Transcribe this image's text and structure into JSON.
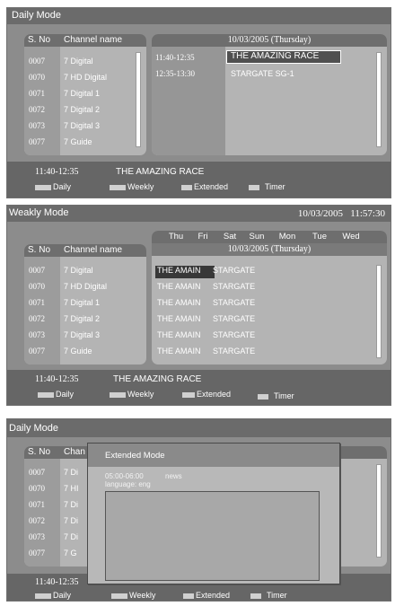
{
  "panel1": {
    "title": "Daily Mode",
    "col_sno": "S. No",
    "col_channel": "Channel name",
    "date_header": "10/03/2005  (Thursday)",
    "channels": [
      {
        "no": "0007",
        "name": "7 Digital"
      },
      {
        "no": "0070",
        "name": "7 HD Digital"
      },
      {
        "no": "0071",
        "name": "7 Digital 1"
      },
      {
        "no": "0072",
        "name": "7 Digital 2"
      },
      {
        "no": "0073",
        "name": "7 Digital 3"
      },
      {
        "no": "0077",
        "name": "7 Guide"
      }
    ],
    "programs": [
      {
        "time": "11:40-12:35",
        "title": "THE AMAZING RACE"
      },
      {
        "time": "12:35-13:30",
        "title": "STARGATE SG-1"
      }
    ],
    "status_time": "11:40-12:35",
    "status_title": "THE AMAZING RACE",
    "legend": {
      "daily": "Daily",
      "weekly": "Weekly",
      "extended": "Extended",
      "timer": "Timer"
    }
  },
  "panel2": {
    "title": "Weakly Mode",
    "datetime": "10/03/2005   11:57:30",
    "days": [
      "Thu",
      "Fri",
      "Sat",
      "Sun",
      "Mon",
      "Tue",
      "Wed"
    ],
    "date_header": "10/03/2005  (Thursday)",
    "col_sno": "S. No",
    "col_channel": "Channel name",
    "channels": [
      {
        "no": "0007",
        "name": "7 Digital"
      },
      {
        "no": "0070",
        "name": "7 HD Digital"
      },
      {
        "no": "0071",
        "name": "7 Digital 1"
      },
      {
        "no": "0072",
        "name": "7 Digital 2"
      },
      {
        "no": "0073",
        "name": "7 Digital 3"
      },
      {
        "no": "0077",
        "name": "7 Guide"
      }
    ],
    "grid": [
      {
        "a": "THE AMAIN",
        "b": "STARGATE"
      },
      {
        "a": "THE AMAIN",
        "b": "STARGATE"
      },
      {
        "a": "THE AMAIN",
        "b": "STARGATE"
      },
      {
        "a": "THE AMAIN",
        "b": "STARGATE"
      },
      {
        "a": "THE AMAIN",
        "b": "STARGATE"
      },
      {
        "a": "THE AMAIN",
        "b": "STARGATE"
      }
    ],
    "status_time": "11:40-12:35",
    "status_title": "THE AMAZING RACE",
    "legend": {
      "daily": "Daily",
      "weekly": "Weekly",
      "extended": "Extended",
      "timer": "Timer"
    }
  },
  "panel3": {
    "title": "Daily Mode",
    "col_sno": "S. No",
    "col_channel": "Chan",
    "channels": [
      {
        "no": "0007",
        "name": "7 Di"
      },
      {
        "no": "0070",
        "name": "7 HI"
      },
      {
        "no": "0071",
        "name": "7 Di"
      },
      {
        "no": "0072",
        "name": "7 Di"
      },
      {
        "no": "0073",
        "name": "7 Di"
      },
      {
        "no": "0077",
        "name": "7 G"
      }
    ],
    "status_time": "11:40-12:35",
    "extended": {
      "title": "Extended Mode",
      "time": "05:00-06:00",
      "program": "news",
      "language": "language: eng"
    },
    "legend": {
      "daily": "Daily",
      "weekly": "Weekly",
      "extended": "Extended",
      "timer": "Timer"
    }
  },
  "colors": {
    "background": "#8c8c8c",
    "titlebar": "#6b6b6b",
    "panel": "#b4b4b4",
    "selected": "#383838"
  }
}
